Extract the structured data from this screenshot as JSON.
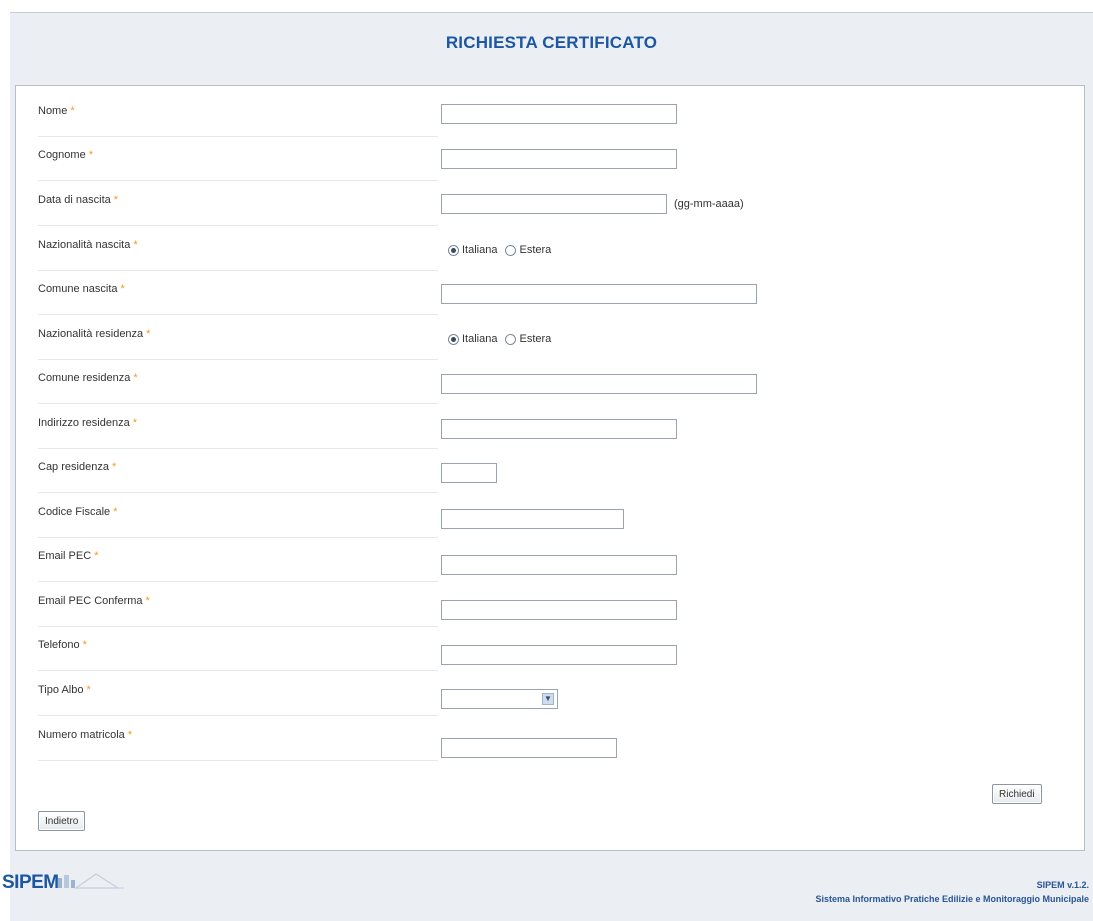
{
  "title": "RICHIESTA CERTIFICATO",
  "required_marker": "*",
  "form": {
    "nome": {
      "label": "Nome"
    },
    "cognome": {
      "label": "Cognome"
    },
    "data_nascita": {
      "label": "Data di nascita",
      "hint": "(gg-mm-aaaa)"
    },
    "nazionalita_nascita": {
      "label": "Nazionalità nascita",
      "option_1": "Italiana",
      "option_2": "Estera",
      "selected": "Italiana"
    },
    "comune_nascita": {
      "label": "Comune nascita"
    },
    "nazionalita_residenza": {
      "label": "Nazionalità residenza",
      "option_1": "Italiana",
      "option_2": "Estera",
      "selected": "Italiana"
    },
    "comune_residenza": {
      "label": "Comune residenza"
    },
    "indirizzo_residenza": {
      "label": "Indirizzo residenza"
    },
    "cap_residenza": {
      "label": "Cap residenza"
    },
    "codice_fiscale": {
      "label": "Codice Fiscale"
    },
    "email_pec": {
      "label": "Email PEC"
    },
    "email_pec_conferma": {
      "label": "Email PEC Conferma"
    },
    "telefono": {
      "label": "Telefono"
    },
    "tipo_albo": {
      "label": "Tipo Albo",
      "value": ""
    },
    "numero_matricola": {
      "label": "Numero matricola"
    }
  },
  "buttons": {
    "richiedi": "Richiedi",
    "indietro": "Indietro"
  },
  "footer": {
    "logo": "SIPEM",
    "version": "SIPEM v.1.2.",
    "description": "Sistema Informativo Pratiche Edilizie e Monitoraggio Municipale"
  },
  "colors": {
    "title": "#1d57a3",
    "required": "#f29b21",
    "background": "#ebeef2"
  }
}
